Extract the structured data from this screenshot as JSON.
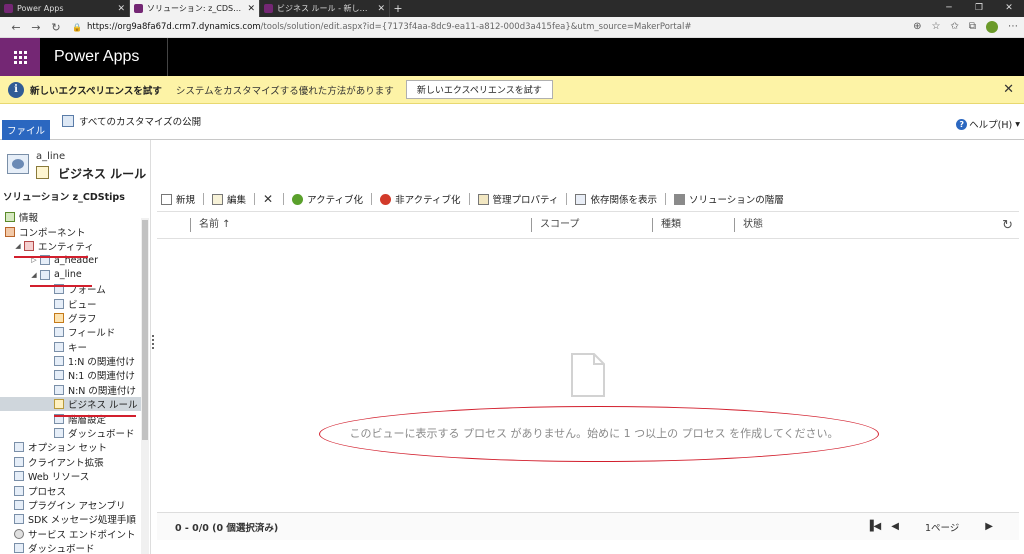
{
  "browser": {
    "tabs": [
      {
        "title": "Power Apps",
        "active": false
      },
      {
        "title": "ソリューション: z_CDStips - Microsoft",
        "active": true
      },
      {
        "title": "ビジネス ルール - 新しいルール - Micr",
        "active": false
      }
    ],
    "url_host": "https://org9a8fa67d.crm7.dynamics.com",
    "url_path": "/tools/solution/edit.aspx?id={7173f4aa-8dc9-ea11-a812-000d3a415fea}&utm_source=MakerPortal#"
  },
  "app": {
    "title": "Power Apps"
  },
  "notice": {
    "title": "新しいエクスペリエンスを試す",
    "message": "システムをカスタマイズする優れた方法があります",
    "button": "新しいエクスペリエンスを試す"
  },
  "ribbon": {
    "file_tab": "ファイル",
    "publish": "すべてのカスタマイズの公開",
    "help": "ヘルプ(H)"
  },
  "sidebar": {
    "entity": "a_line",
    "page_title": "ビジネス ルール",
    "solution": "ソリューション z_CDStips",
    "items": [
      {
        "label": "情報"
      },
      {
        "label": "コンポーネント"
      },
      {
        "label": "エンティティ"
      },
      {
        "label": "a_header"
      },
      {
        "label": "a_line"
      },
      {
        "label": "フォーム"
      },
      {
        "label": "ビュー"
      },
      {
        "label": "グラフ"
      },
      {
        "label": "フィールド"
      },
      {
        "label": "キー"
      },
      {
        "label": "1:N の関連付け"
      },
      {
        "label": "N:1 の関連付け"
      },
      {
        "label": "N:N の関連付け"
      },
      {
        "label": "ビジネス ルール"
      },
      {
        "label": "階層設定"
      },
      {
        "label": "ダッシュボード"
      },
      {
        "label": "オプション セット"
      },
      {
        "label": "クライアント拡張"
      },
      {
        "label": "Web リソース"
      },
      {
        "label": "プロセス"
      },
      {
        "label": "プラグイン アセンブリ"
      },
      {
        "label": "SDK メッセージ処理手順"
      },
      {
        "label": "サービス エンドポイント"
      },
      {
        "label": "ダッシュボード"
      }
    ]
  },
  "toolbar": {
    "new": "新規",
    "edit": "編集",
    "activate": "アクティブ化",
    "deactivate": "非アクティブ化",
    "properties": "管理プロパティ",
    "dependencies": "依存関係を表示",
    "layers": "ソリューションの階層"
  },
  "grid": {
    "columns": {
      "name": "名前 ↑",
      "scope": "スコープ",
      "type": "種類",
      "status": "状態"
    },
    "empty_message": "このビューに表示する プロセス がありません。始めに 1 つ以上の プロセス を作成してください。",
    "count": "0 - 0/0 (0 個選択済み)",
    "page": "1ページ"
  },
  "colors": {
    "accent": "#742774",
    "file_tab": "#2b67c0",
    "notice_bg": "#fdf3a6",
    "annotation": "#d21f2d"
  }
}
